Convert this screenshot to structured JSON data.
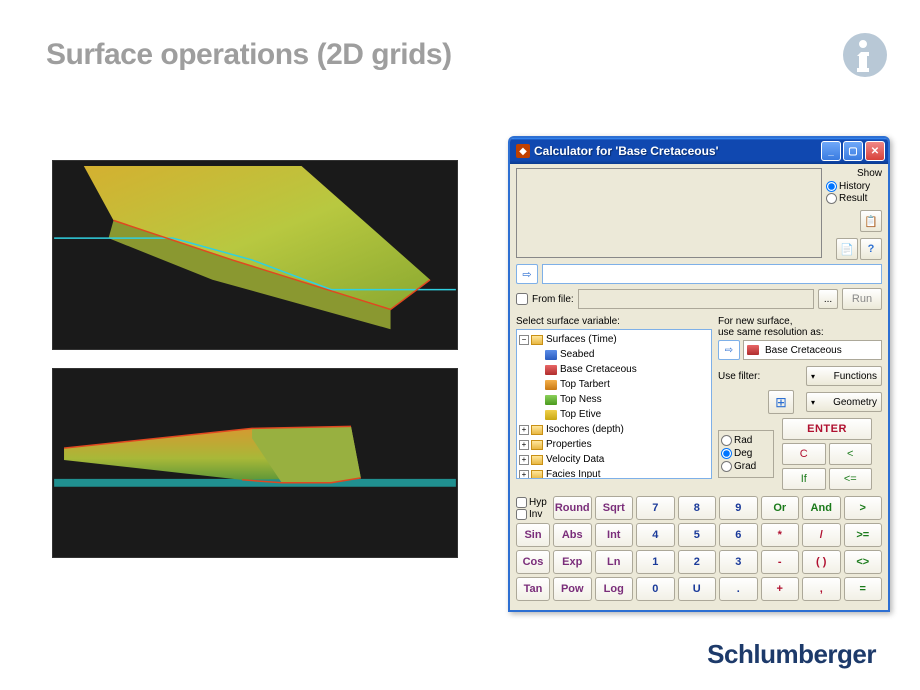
{
  "slide": {
    "title": "Surface operations (2D grids)"
  },
  "window": {
    "title": "Calculator for 'Base Cretaceous'",
    "show_label": "Show",
    "show_history": "History",
    "show_result": "Result",
    "from_file_label": "From file:",
    "browse_label": "...",
    "run_label": "Run",
    "select_label": "Select surface variable:",
    "tree": {
      "root": "Surfaces (Time)",
      "items": [
        "Seabed",
        "Base Cretaceous",
        "Top Tarbert",
        "Top Ness",
        "Top Etive"
      ],
      "folders": [
        "Isochores (depth)",
        "Properties",
        "Velocity Data",
        "Facies Input"
      ]
    },
    "newsurf_label1": "For new surface,",
    "newsurf_label2": "use same resolution as:",
    "newsurf_value": "Base Cretaceous",
    "usefilter_label": "Use filter:",
    "functions_label": "Functions",
    "geometry_label": "Geometry",
    "enter_label": "ENTER",
    "angle": {
      "rad": "Rad",
      "deg": "Deg",
      "grad": "Grad"
    },
    "ops": {
      "c": "C",
      "back": "<",
      "if": "If",
      "le": "<=",
      "hyp": "Hyp",
      "inv": "Inv"
    },
    "rows": [
      [
        "Round",
        "Sqrt",
        "7",
        "8",
        "9",
        "Or",
        "And",
        ">"
      ],
      [
        "Sin",
        "Abs",
        "Int",
        "4",
        "5",
        "6",
        "*",
        "/",
        ">="
      ],
      [
        "Cos",
        "Exp",
        "Ln",
        "1",
        "2",
        "3",
        "-",
        "( )",
        "<>"
      ],
      [
        "Tan",
        "Pow",
        "Log",
        "0",
        "U",
        ".",
        "+",
        ",",
        "="
      ]
    ]
  },
  "brand": "Schlumberger"
}
